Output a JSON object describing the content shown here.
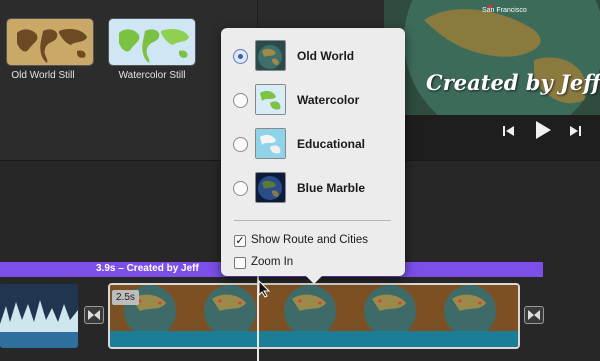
{
  "browser": {
    "thumbnails": [
      {
        "label": "Old World Still"
      },
      {
        "label": "Watercolor Still"
      }
    ]
  },
  "viewer": {
    "title_text": "Created by Jeff",
    "city_label": "San Francisco"
  },
  "timeline": {
    "title_bar_label": "3.9s –  Created by Jeff",
    "clip_duration": "2.5s"
  },
  "popover": {
    "themes": [
      {
        "label": "Old World",
        "selected": true
      },
      {
        "label": "Watercolor",
        "selected": false
      },
      {
        "label": "Educational",
        "selected": false
      },
      {
        "label": "Blue Marble",
        "selected": false
      }
    ],
    "options": [
      {
        "label": "Show Route and Cities",
        "checked": true
      },
      {
        "label": "Zoom In",
        "checked": false
      }
    ]
  },
  "colors": {
    "title_bar": "#7b4fe8",
    "clip_bottom": "#1b7d96",
    "popover_bg": "#ececec"
  }
}
